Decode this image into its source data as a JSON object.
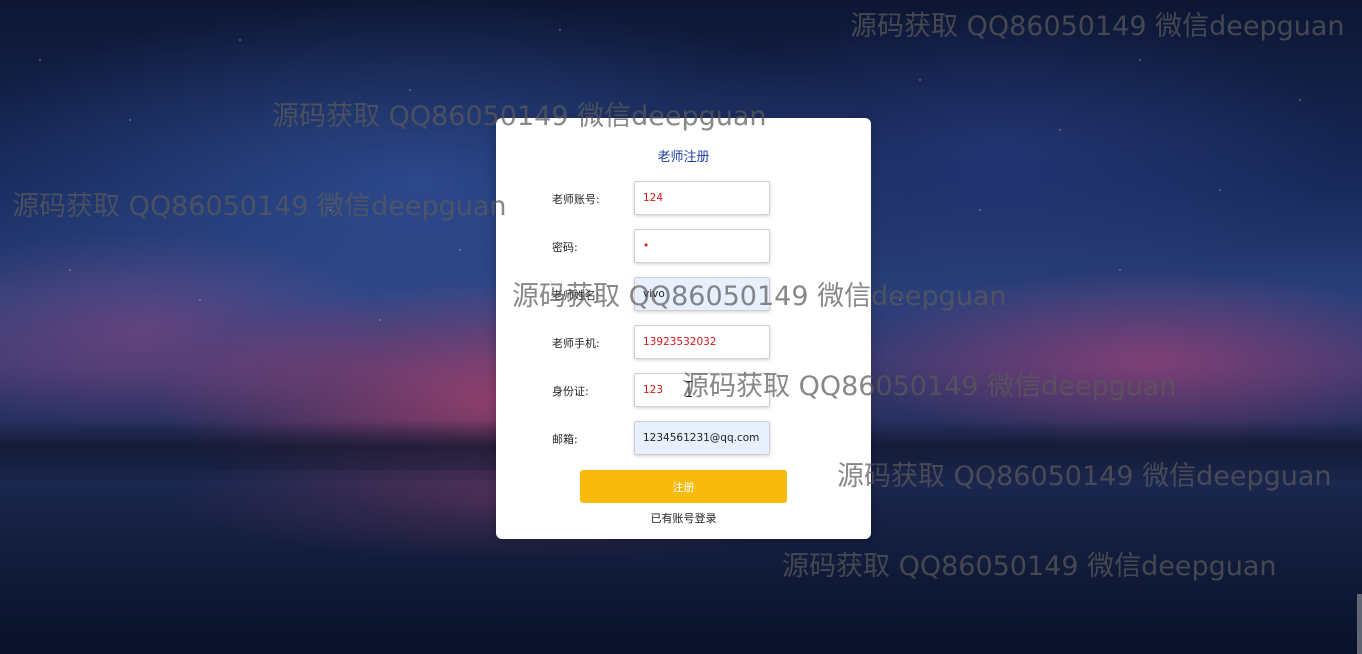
{
  "form": {
    "title": "老师注册",
    "fields": [
      {
        "label": "老师账号:",
        "value": "124"
      },
      {
        "label": "密码:",
        "value": "•"
      },
      {
        "label": "老师姓名:",
        "value": "vivo"
      },
      {
        "label": "老师手机:",
        "value": "13923532032"
      },
      {
        "label": "身份证:",
        "value": "123"
      },
      {
        "label": "邮箱:",
        "value": "1234561231@qq.com"
      }
    ],
    "submit_label": "注册",
    "login_link": "已有账号登录"
  },
  "watermark_text": "源码获取 QQ86050149 微信deepguan",
  "colors": {
    "accent_button": "#f8bb0b",
    "title": "#1f3e9e",
    "input_text": "#d11a1a"
  }
}
